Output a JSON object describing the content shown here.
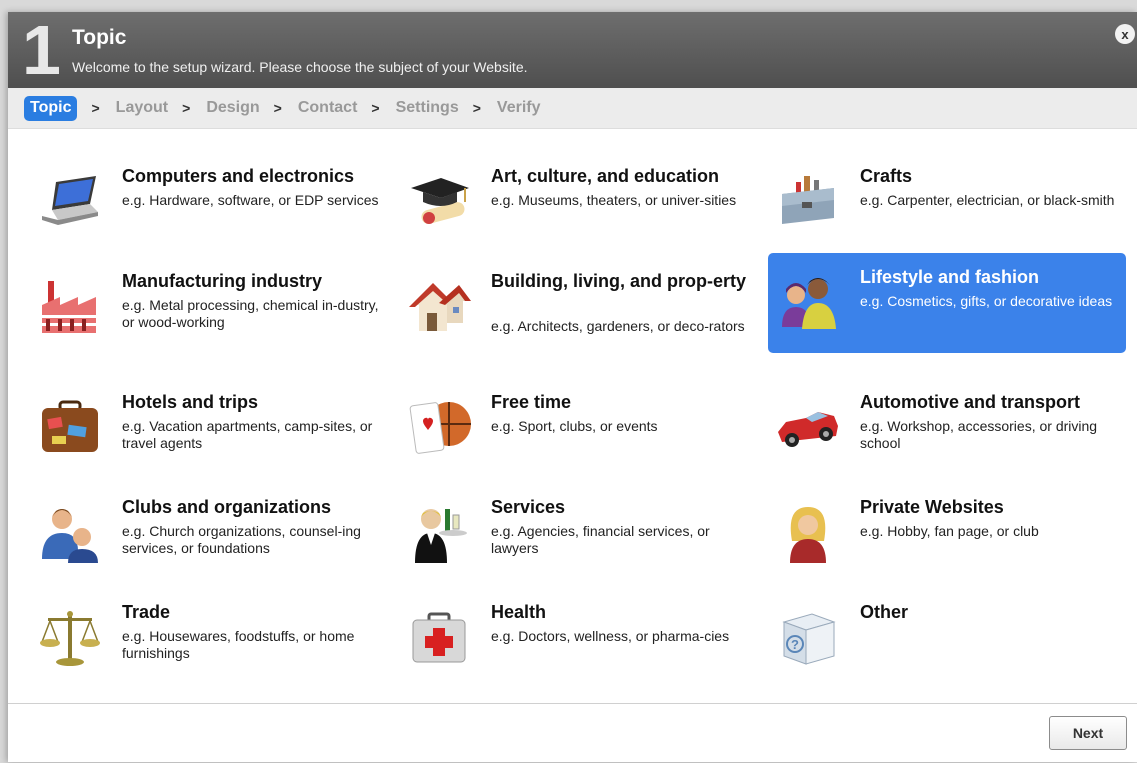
{
  "header": {
    "step_number": "1",
    "title": "Topic",
    "subtitle": "Welcome to the setup wizard. Please choose the subject of your Website.",
    "close_label": "x"
  },
  "steps": [
    {
      "label": "Topic",
      "active": true
    },
    {
      "label": "Layout",
      "active": false
    },
    {
      "label": "Design",
      "active": false
    },
    {
      "label": "Contact",
      "active": false
    },
    {
      "label": "Settings",
      "active": false
    },
    {
      "label": "Verify",
      "active": false
    }
  ],
  "step_separator": ">",
  "topics": [
    {
      "title": "Computers and electronics",
      "desc": "e.g. Hardware, software, or EDP services",
      "icon": "laptop-icon",
      "selected": false
    },
    {
      "title": "Art, culture, and education",
      "desc": "e.g. Museums, theaters, or univer-sities",
      "icon": "graduation-cap-icon",
      "selected": false
    },
    {
      "title": "Crafts",
      "desc": "e.g. Carpenter, electrician, or black-smith",
      "icon": "toolbox-icon",
      "selected": false
    },
    {
      "title": "Manufacturing industry",
      "desc": "e.g. Metal processing, chemical in-dustry, or wood-working",
      "icon": "factory-icon",
      "selected": false
    },
    {
      "title": "Building, living, and prop-erty",
      "desc": "e.g. Architects, gardeners, or deco-rators",
      "icon": "house-icon",
      "selected": false
    },
    {
      "title": "Lifestyle and fashion",
      "desc": "e.g. Cosmetics, gifts, or decorative ideas",
      "icon": "people-fashion-icon",
      "selected": true
    },
    {
      "title": "Hotels and trips",
      "desc": "e.g. Vacation apartments, camp-sites, or travel agents",
      "icon": "suitcase-icon",
      "selected": false
    },
    {
      "title": "Free time",
      "desc": "e.g. Sport, clubs, or events",
      "icon": "playing-card-ball-icon",
      "selected": false
    },
    {
      "title": "Automotive and transport",
      "desc": "e.g. Workshop, accessories, or driving school",
      "icon": "car-icon",
      "selected": false
    },
    {
      "title": "Clubs and organizations",
      "desc": "e.g. Church organizations, counsel-ing services, or foundations",
      "icon": "group-icon",
      "selected": false
    },
    {
      "title": "Services",
      "desc": "e.g. Agencies, financial services, or lawyers",
      "icon": "waiter-icon",
      "selected": false
    },
    {
      "title": "Private Websites",
      "desc": "e.g. Hobby, fan page, or club",
      "icon": "woman-icon",
      "selected": false
    },
    {
      "title": "Trade",
      "desc": "e.g. Housewares, foodstuffs, or home furnishings",
      "icon": "scales-icon",
      "selected": false
    },
    {
      "title": "Health",
      "desc": "e.g. Doctors, wellness, or pharma-cies",
      "icon": "first-aid-kit-icon",
      "selected": false
    },
    {
      "title": "Other",
      "desc": "",
      "icon": "question-box-icon",
      "selected": false
    }
  ],
  "footer": {
    "next_label": "Next"
  },
  "colors": {
    "accent": "#2a7de1",
    "selected_tile": "#3b82ea",
    "header_bg": "#5a5a5a"
  }
}
